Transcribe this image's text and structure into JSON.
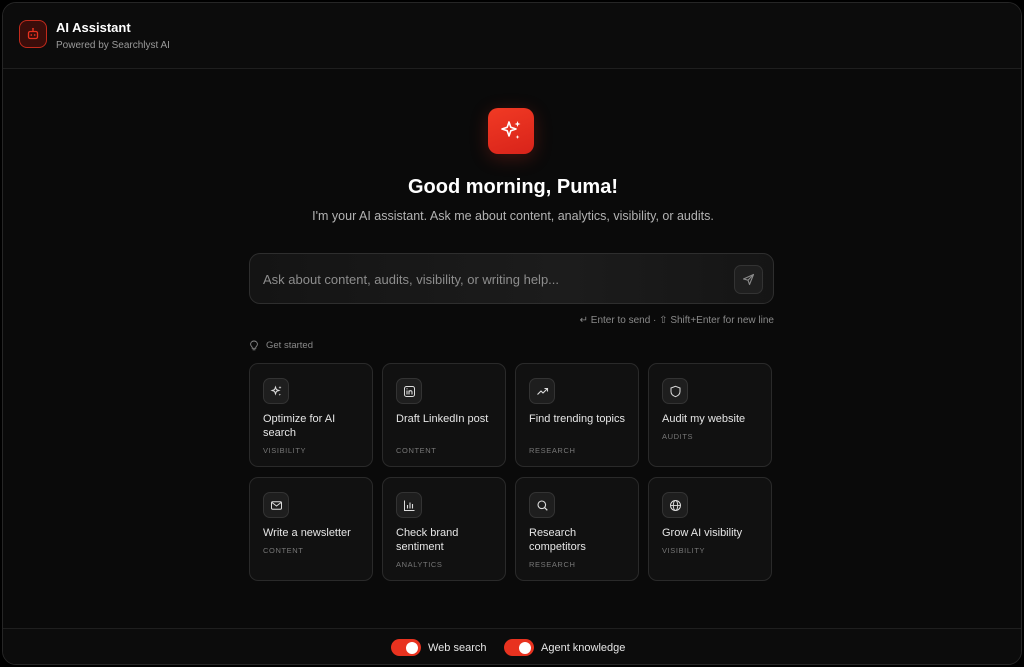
{
  "header": {
    "title": "AI Assistant",
    "subtitle": "Powered by Searchlyst AI",
    "logo_icon": "robot-icon"
  },
  "hero": {
    "icon": "sparkles-icon",
    "greeting": "Good morning, Puma!",
    "intro": "I'm your AI assistant. Ask me about content, analytics, visibility, or audits."
  },
  "composer": {
    "placeholder": "Ask about content, audits, visibility, or writing help...",
    "value": "",
    "send_icon": "send-icon",
    "hint": "↵ Enter to send · ⇧ Shift+Enter for new line"
  },
  "get_started": {
    "label": "Get started",
    "icon": "lightbulb-icon"
  },
  "suggestions": [
    {
      "title": "Optimize for AI search",
      "tag": "VISIBILITY",
      "icon": "sparkles-icon"
    },
    {
      "title": "Draft LinkedIn post",
      "tag": "CONTENT",
      "icon": "linkedin-icon"
    },
    {
      "title": "Find trending topics",
      "tag": "RESEARCH",
      "icon": "trending-up-icon"
    },
    {
      "title": "Audit my website",
      "tag": "AUDITS",
      "icon": "shield-icon"
    },
    {
      "title": "Write a newsletter",
      "tag": "CONTENT",
      "icon": "mail-icon"
    },
    {
      "title": "Check brand sentiment",
      "tag": "ANALYTICS",
      "icon": "bar-chart-icon"
    },
    {
      "title": "Research competitors",
      "tag": "RESEARCH",
      "icon": "search-icon"
    },
    {
      "title": "Grow AI visibility",
      "tag": "VISIBILITY",
      "icon": "globe-icon"
    }
  ],
  "footer": {
    "toggles": [
      {
        "label": "Web search",
        "on": true
      },
      {
        "label": "Agent knowledge",
        "on": true
      }
    ]
  },
  "colors": {
    "accent": "#E8321F",
    "background": "#0A0A0A",
    "card": "#111111"
  }
}
